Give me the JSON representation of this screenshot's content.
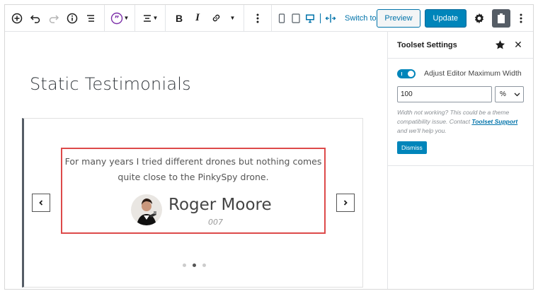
{
  "toolbar": {
    "icons": [
      "add-block-icon",
      "undo-icon",
      "redo-icon",
      "info-icon",
      "list-view-icon",
      "quote-icon",
      "align-icon",
      "link-icon",
      "more-options-icon",
      "mobile-preview-icon",
      "tablet-preview-icon",
      "desktop-preview-icon",
      "resize-icon"
    ],
    "bold_label": "B",
    "italic_label": "I",
    "switch_to_draft": "Switch to Draft",
    "preview_label": "Preview",
    "update_label": "Update"
  },
  "editor": {
    "page_title": "Static Testimonials",
    "testimonial": {
      "quote": "For many years I tried different drones but nothing comes quite close to the PinkySpy drone.",
      "name": "Roger Moore",
      "role": "007"
    },
    "slider": {
      "dot_count": 3,
      "active_dot": 2
    }
  },
  "sidebar": {
    "title": "Toolset Settings",
    "toggle_label": "Adjust Editor Maximum Width",
    "toggle_on": true,
    "width_value": "100",
    "unit_value": "%",
    "help_text_before": "Width not working? This could be a theme compatibility issue. Contact ",
    "help_link": "Toolset Support",
    "help_text_after": " and we'll help you.",
    "dismiss_label": "Dismiss"
  },
  "colors": {
    "accent": "#0085ba",
    "link": "#0073aa",
    "highlight_border": "#dd4a4a"
  }
}
